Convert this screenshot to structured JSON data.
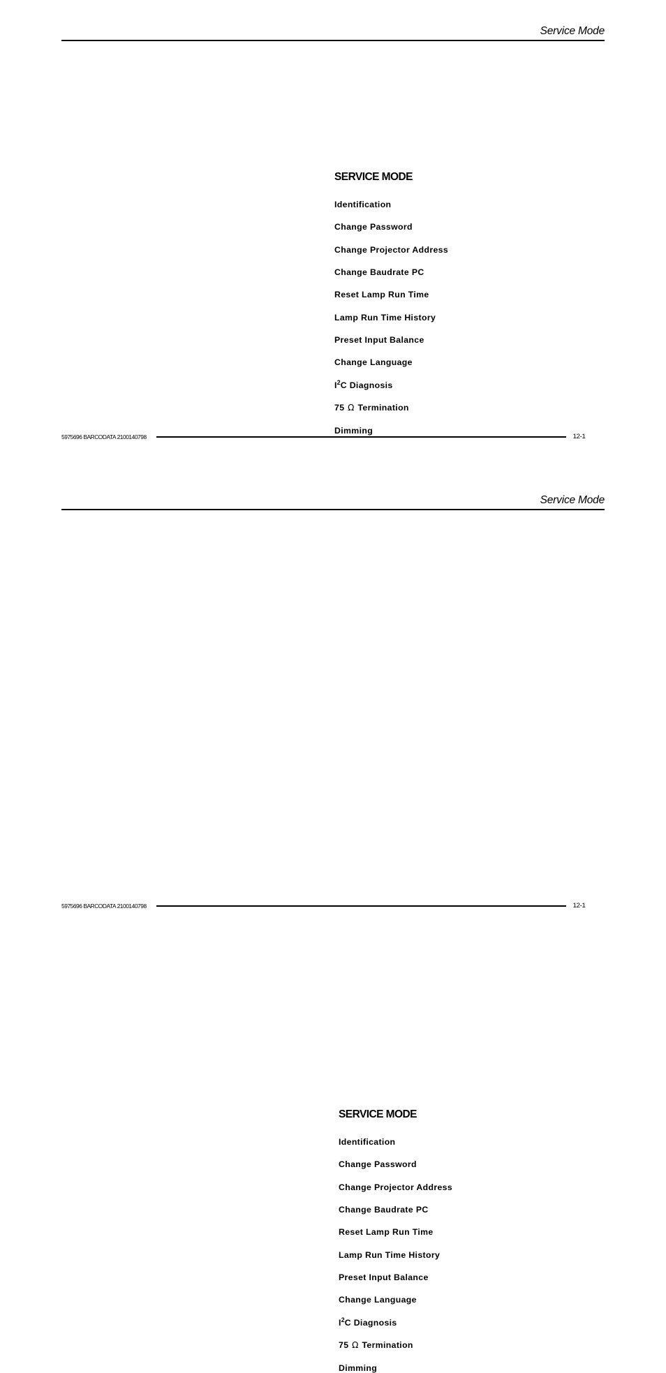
{
  "document": {
    "header_title": "Service Mode",
    "footer_code": "5975696 BARCODATA 2100140798",
    "footer_page": "12-1"
  },
  "pages": [
    {
      "header_title": "Service Mode",
      "menu": {
        "title": "SERVICE MODE",
        "items": [
          "Identification",
          "Change  Password",
          "Change  Projector  Address",
          "Change  Baudrate  PC",
          "Reset  Lamp  Run  Time",
          "Lamp  Run  Time  History",
          "Preset  Input  Balance",
          "Change  Language",
          "I2C  Diagnosis",
          "75  Ω  Termination",
          "Dimming"
        ],
        "item_i2c_prefix": "I",
        "item_i2c_sup": "2",
        "item_i2c_suffix": "C  Diagnosis",
        "item_ohm_prefix": "75 ",
        "item_ohm_symbol": "Ω",
        "item_ohm_suffix": " Termination"
      },
      "footer_code": "5975696 BARCODATA 2100140798",
      "footer_page": "12-1"
    },
    {
      "header_title": "Service Mode",
      "menu": {
        "title": "SERVICE MODE",
        "items": [
          "Identification",
          "Change  Password",
          "Change  Projector  Address",
          "Change  Baudrate  PC",
          "Reset  Lamp  Run  Time",
          "Lamp  Run  Time  History",
          "Preset  Input  Balance",
          "Change  Language",
          "I2C  Diagnosis",
          "75  Ω  Termination",
          "Dimming"
        ],
        "item_i2c_prefix": "I",
        "item_i2c_sup": "2",
        "item_i2c_suffix": "C  Diagnosis",
        "item_ohm_prefix": "75 ",
        "item_ohm_symbol": "Ω",
        "item_ohm_suffix": " Termination"
      },
      "footer_code": "5975696 BARCODATA 2100140798",
      "footer_page": "12-1"
    }
  ]
}
